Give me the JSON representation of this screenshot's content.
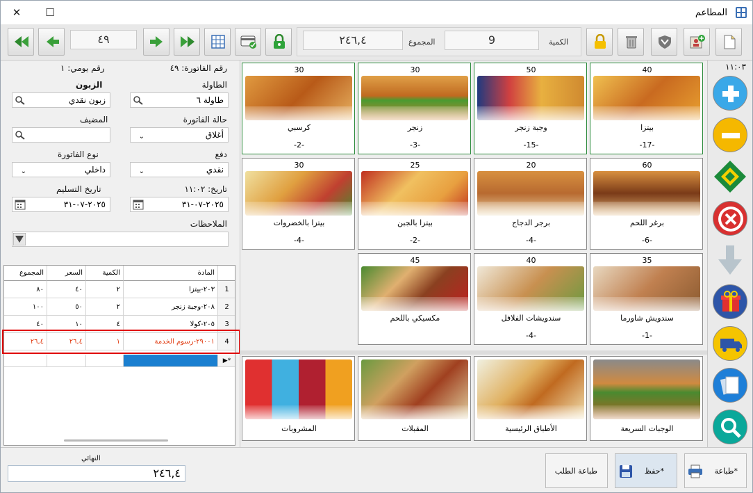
{
  "window": {
    "title": "المطاعم",
    "close": "✕",
    "maximize": "☐"
  },
  "toolbar": {
    "invoice_nav_value": "٤٩",
    "quantity_label": "الكمية",
    "quantity_value": "9",
    "total_label": "المجموع",
    "total_value": "٢٤٦,٤"
  },
  "clock": "١١:٠٣",
  "invoice": {
    "number_label": "رقم الفاتورة: ٤٩",
    "daily_label": "رقم يومي: ١",
    "customer_label": "الزبون",
    "customer_value": "زبون نقدي",
    "table_label": "الطاولة",
    "table_value": "طاولة ٦",
    "host_label": "المضيف",
    "host_value": "",
    "status_label": "حالة الفاتورة",
    "status_value": "أغلاق",
    "type_label": "نوع الفاتورة",
    "type_value": "داخلي",
    "payment_label": "دفع",
    "payment_value": "نقدي",
    "delivery_date_label": "تاريخ التسليم",
    "delivery_date_value": "٢٠٢٥-٠٧-٣١",
    "date_label": "تاريخ: ١١:٠٢",
    "date_value": "٢٠٢٥-٠٧-٣١",
    "notes_label": "الملاحظات",
    "notes_value": ""
  },
  "order_table": {
    "headers": {
      "item": "المادة",
      "qty": "الكمية",
      "price": "السعر",
      "total": "المجموع"
    },
    "rows": [
      {
        "n": "1",
        "item": "٢٠٣-بيتزا",
        "qty": "٢",
        "price": "٤٠",
        "total": "٨٠"
      },
      {
        "n": "2",
        "item": "٢٠٨-وجبة زنجر",
        "qty": "٢",
        "price": "٥٠",
        "total": "١٠٠"
      },
      {
        "n": "3",
        "item": "٢٠٥-كولا",
        "qty": "٤",
        "price": "١٠",
        "total": "٤٠"
      },
      {
        "n": "4",
        "item": "٢٩٠٠١-رسوم الخدمة",
        "qty": "١",
        "price": "٢٦,٤",
        "total": "٢٦,٤"
      }
    ]
  },
  "menu_items": [
    {
      "name": "بيتزا",
      "price": "40",
      "qty": "-17-"
    },
    {
      "name": "وجبة زنجر",
      "price": "50",
      "qty": "-15-"
    },
    {
      "name": "زنجر",
      "price": "30",
      "qty": "-3-"
    },
    {
      "name": "كرسبي",
      "price": "30",
      "qty": "-2-"
    },
    {
      "name": "برغر اللحم",
      "price": "60",
      "qty": "-6-"
    },
    {
      "name": "برجر الدجاج",
      "price": "20",
      "qty": "-4-"
    },
    {
      "name": "بيتزا بالجبن",
      "price": "25",
      "qty": "-2-"
    },
    {
      "name": "بيتزا بالخضروات",
      "price": "30",
      "qty": "-4-"
    },
    {
      "name": "سندويش شاورما",
      "price": "35",
      "qty": "-1-"
    },
    {
      "name": "سندويشات الفلافل",
      "price": "40",
      "qty": "-4-"
    },
    {
      "name": "مكسيكي باللحم",
      "price": "45",
      "qty": ""
    }
  ],
  "categories": [
    {
      "name": "الوجبات السريعة"
    },
    {
      "name": "الأطباق الرئيسية"
    },
    {
      "name": "المقبلات"
    },
    {
      "name": "المشروبات"
    }
  ],
  "bottom": {
    "final_label": "النهائي",
    "final_value": "٢٤٦,٤",
    "print_label": "طباعة*",
    "save_label": "حفظ*",
    "print_order_label": "طباعة الطلب"
  },
  "colors": {
    "accent_blue": "#1a7fd0",
    "hilite_red": "#e00000",
    "service_text": "#e03a10"
  }
}
